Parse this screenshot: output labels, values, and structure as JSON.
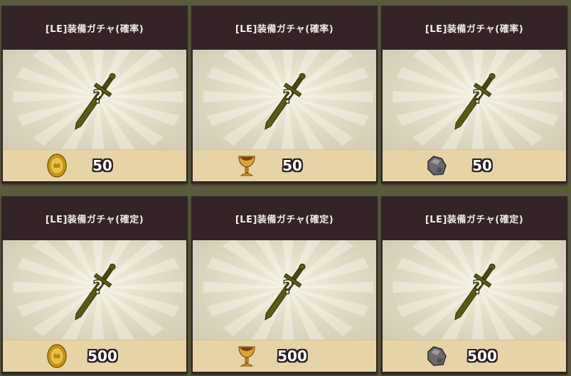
{
  "cards": [
    {
      "title": "[LE]装備ガチャ(確率)",
      "cost": "50",
      "currency": "gold-coin"
    },
    {
      "title": "[LE]装備ガチャ(確率)",
      "cost": "50",
      "currency": "golden-chalice"
    },
    {
      "title": "[LE]装備ガチャ(確率)",
      "cost": "50",
      "currency": "ore-stone"
    },
    {
      "title": "[LE]装備ガチャ(確定)",
      "cost": "500",
      "currency": "gold-coin"
    },
    {
      "title": "[LE]装備ガチャ(確定)",
      "cost": "500",
      "currency": "golden-chalice"
    },
    {
      "title": "[LE]装備ガチャ(確定)",
      "cost": "500",
      "currency": "ore-stone"
    }
  ],
  "art": {
    "icon": "mystery-sword",
    "mark": "?"
  },
  "colors": {
    "title_bar": "#342428",
    "price_bar": "#e6d4a7",
    "sword": "#5b5a14"
  }
}
